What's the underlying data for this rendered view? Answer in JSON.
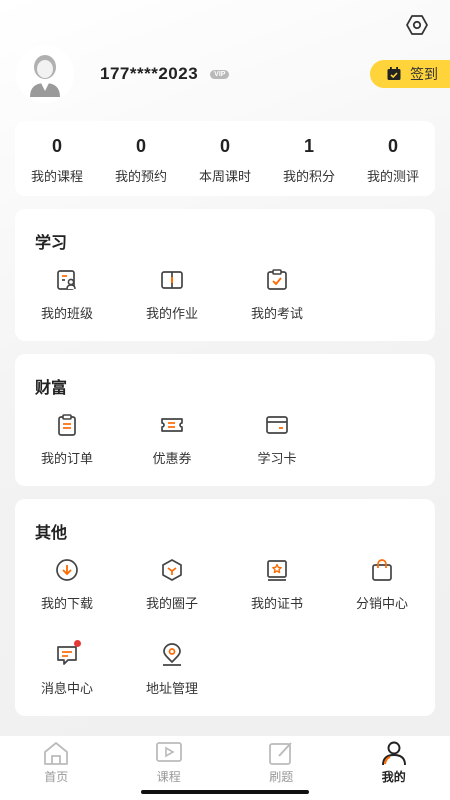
{
  "profile": {
    "phone": "177****2023",
    "vip": "VIP",
    "signin_label": "签到"
  },
  "stats": [
    {
      "value": "0",
      "label": "我的课程"
    },
    {
      "value": "0",
      "label": "我的预约"
    },
    {
      "value": "0",
      "label": "本周课时"
    },
    {
      "value": "1",
      "label": "我的积分"
    },
    {
      "value": "0",
      "label": "我的测评"
    }
  ],
  "study": {
    "title": "学习",
    "items": [
      "我的班级",
      "我的作业",
      "我的考试"
    ]
  },
  "wealth": {
    "title": "财富",
    "items": [
      "我的订单",
      "优惠券",
      "学习卡"
    ]
  },
  "other": {
    "title": "其他",
    "items": [
      "我的下载",
      "我的圈子",
      "我的证书",
      "分销中心",
      "消息中心",
      "地址管理"
    ]
  },
  "tabs": [
    "首页",
    "课程",
    "刷题",
    "我的"
  ],
  "colors": {
    "accent": "#ff6a00",
    "signin": "#ffd43b",
    "icon": "#444444"
  }
}
